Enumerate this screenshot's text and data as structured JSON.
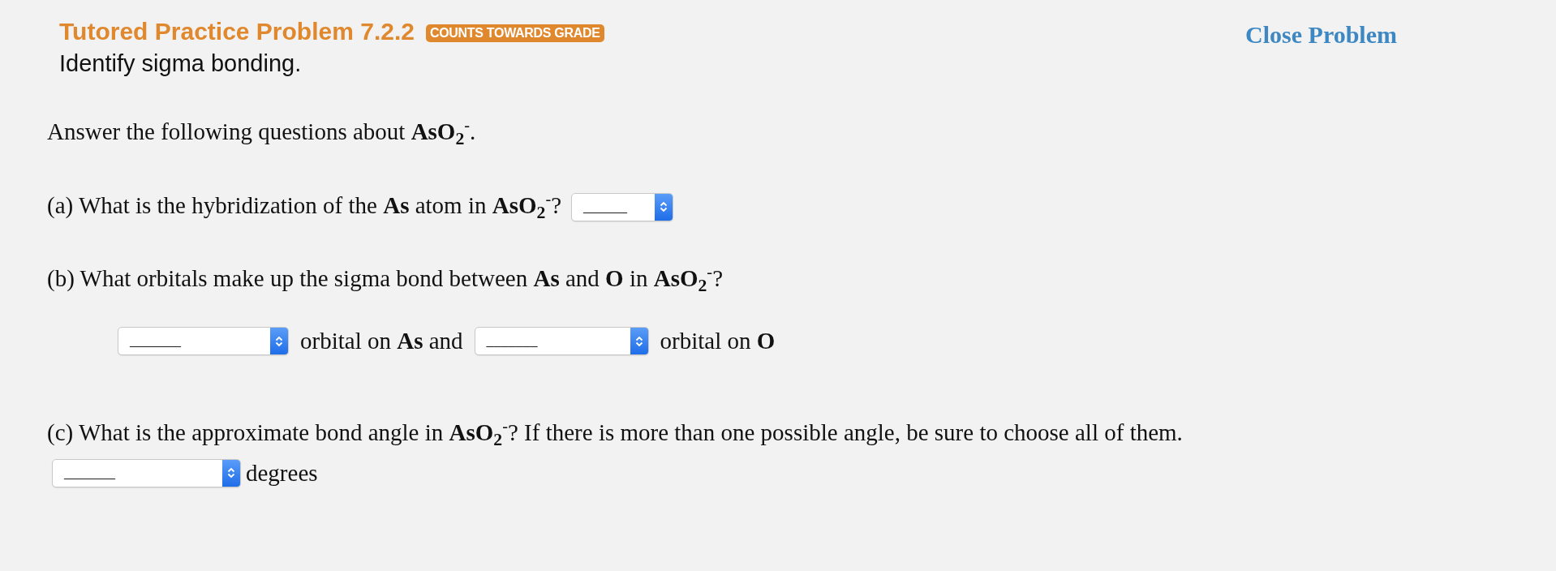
{
  "header": {
    "title": "Tutored Practice Problem 7.2.2",
    "badge": "COUNTS TOWARDS GRADE",
    "subtitle": "Identify sigma bonding.",
    "close_link": "Close Problem"
  },
  "intro": "Answer the following questions about **AsO**$_{2}$$^{-}$.",
  "questions": [
    {
      "prompt": "(a) What is the hybridization of the **As** atom in **AsO**$_{2}$$^{-}$?",
      "inline_select": {
        "value": "______"
      }
    },
    {
      "prompt": "(b) What orbitals make up the sigma bond between **As** and **O** in **AsO**$_{2}$$^{-}$?",
      "row": [
        {
          "kind": "select",
          "value": "_______"
        },
        {
          "kind": "text",
          "text": "orbital on **As** and"
        },
        {
          "kind": "select",
          "value": "_______"
        },
        {
          "kind": "text",
          "text": "orbital on **O**"
        }
      ]
    },
    {
      "prompt": "(c) What is the approximate bond angle in **AsO**$_{2}$$^{-}$? If there is more than one possible angle, be sure to choose all of them.",
      "row": [
        {
          "kind": "select",
          "value": "_______"
        },
        {
          "kind": "text",
          "text": "degrees"
        }
      ]
    }
  ]
}
